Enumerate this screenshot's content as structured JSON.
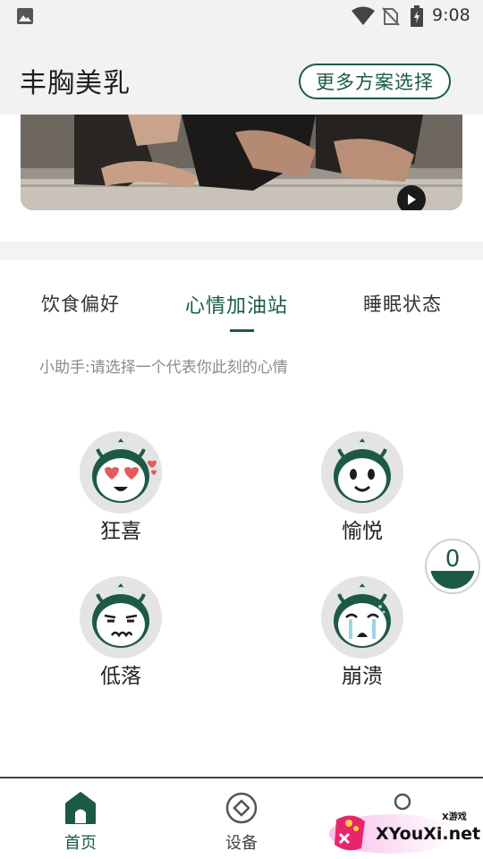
{
  "status_bar": {
    "time": "9:08"
  },
  "header": {
    "title": "丰胸美乳",
    "more_button": "更多方案选择"
  },
  "video": {
    "play_icon": "play-icon"
  },
  "tabs": [
    {
      "label": "饮食偏好",
      "active": false
    },
    {
      "label": "心情加油站",
      "active": true
    },
    {
      "label": "睡眠状态",
      "active": false
    }
  ],
  "hint": "小助手:请选择一个代表你此刻的心情",
  "moods": [
    {
      "label": "狂喜",
      "icon": "heart-eyes-face-icon"
    },
    {
      "label": "愉悦",
      "icon": "smile-face-icon"
    },
    {
      "label": "低落",
      "icon": "sad-face-icon"
    },
    {
      "label": "崩溃",
      "icon": "crying-face-icon"
    }
  ],
  "counter": {
    "value": "0"
  },
  "bottom_nav": [
    {
      "label": "首页",
      "icon": "home-icon",
      "active": true
    },
    {
      "label": "设备",
      "icon": "device-icon",
      "active": false
    },
    {
      "label": "",
      "icon": "profile-icon",
      "active": false
    }
  ],
  "watermark": {
    "text": "XYouXi.net",
    "small": "X游戏"
  },
  "colors": {
    "accent": "#1c5a46",
    "header_bg": "#f2f2f2"
  }
}
